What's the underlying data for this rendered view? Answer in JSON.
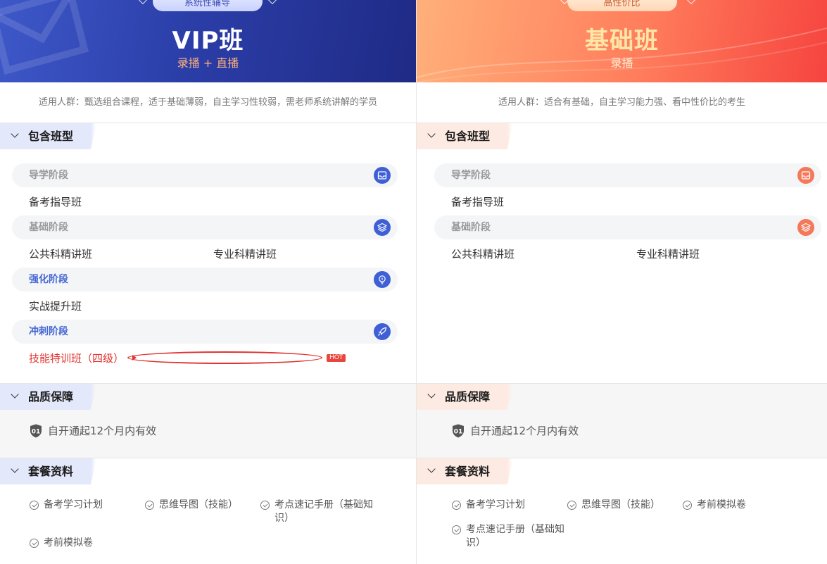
{
  "vip": {
    "pill_label": "系统性辅导",
    "title": "VIP班",
    "subtitle": "录播 + 直播",
    "audience": "适用人群：甄选组合课程，适于基础薄弱，自主学习性较弱，需老师系统讲解的学员",
    "classes_heading": "包含班型",
    "stages": [
      {
        "label": "导学阶段",
        "icon": "inbox-icon",
        "items": [
          "备考指导班"
        ]
      },
      {
        "label": "基础阶段",
        "icon": "layers-icon",
        "items": [
          "公共科精讲班",
          "专业科精讲班"
        ]
      },
      {
        "label": "强化阶段",
        "icon": "lightbulb-icon",
        "items": [
          "实战提升班"
        ]
      },
      {
        "label": "冲刺阶段",
        "icon": "rocket-icon",
        "items": [
          "技能特训班（四级）"
        ]
      }
    ],
    "hot_badge": "HOT",
    "quality_heading": "品质保障",
    "quality_badge": "01",
    "quality_text": "自开通起12个月内有效",
    "materials_heading": "套餐资料",
    "materials": [
      "备考学习计划",
      "思维导图（技能）",
      "考点速记手册（基础知识）",
      "考前模拟卷"
    ]
  },
  "basic": {
    "pill_label": "高性价比",
    "title": "基础班",
    "subtitle": "录播",
    "audience": "适用人群：适合有基础，自主学习能力强、看中性价比的考生",
    "classes_heading": "包含班型",
    "stages": [
      {
        "label": "导学阶段",
        "icon": "inbox-icon",
        "items": [
          "备考指导班"
        ]
      },
      {
        "label": "基础阶段",
        "icon": "layers-icon",
        "items": [
          "公共科精讲班",
          "专业科精讲班"
        ]
      }
    ],
    "quality_heading": "品质保障",
    "quality_badge": "01",
    "quality_text": "自开通起12个月内有效",
    "materials_heading": "套餐资料",
    "materials": [
      "备考学习计划",
      "思维导图（技能）",
      "考前模拟卷",
      "考点速记手册（基础知识）"
    ]
  },
  "colors": {
    "vip_accent": "#3e5fd6",
    "basic_accent": "#f4785a",
    "highlight_red": "#e0332f"
  }
}
